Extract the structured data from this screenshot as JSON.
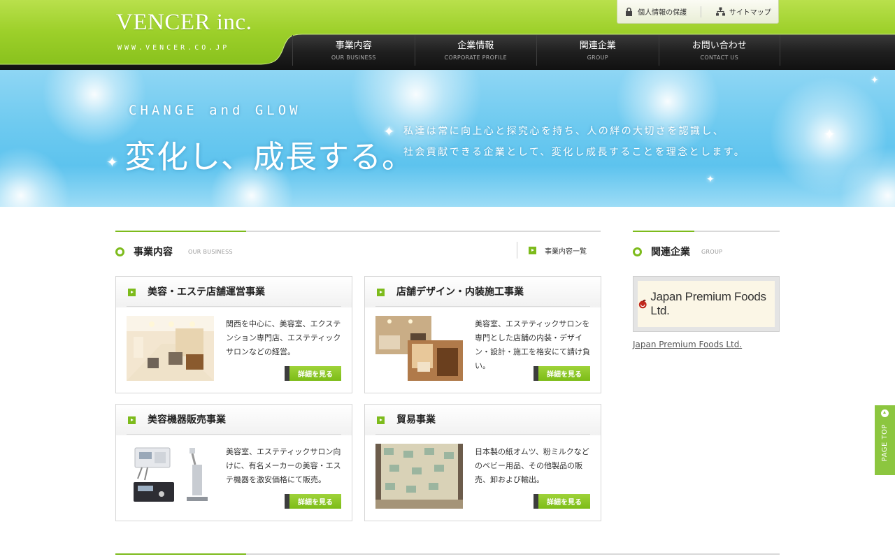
{
  "header": {
    "logo_title": "VENCER inc.",
    "logo_url": "WWW.VENCER.CO.JP",
    "util_links": [
      {
        "label": "個人情報の保護",
        "icon": "lock-icon"
      },
      {
        "label": "サイトマップ",
        "icon": "sitemap-icon"
      }
    ],
    "nav": [
      {
        "jp": "事業内容",
        "en": "OUR BUSINESS"
      },
      {
        "jp": "企業情報",
        "en": "CORPORATE PROFILE"
      },
      {
        "jp": "関連企業",
        "en": "GROUP"
      },
      {
        "jp": "お問い合わせ",
        "en": "CONTACT US"
      }
    ]
  },
  "hero": {
    "sub": "CHANGE and GLOW",
    "main": "変化し、成長する。",
    "text1": "私達は常に向上心と探究心を持ち、人の絆の大切さを認識し、",
    "text2": "社会貢献できる企業として、変化し成長することを理念とします。"
  },
  "business": {
    "title": "事業内容",
    "en": "OUR BUSINESS",
    "more_label": "事業内容一覧",
    "detail_label": "詳細を見る",
    "cards": [
      {
        "title": "美容・エステ店舗運営事業",
        "desc": "関西を中心に、美容室、エクステンション専門店、エステティックサロンなどの経営。"
      },
      {
        "title": "店舗デザイン・内装施工事業",
        "desc": "美容室、エステティックサロンを専門とした店舗の内装・デザイン・設計・施工を格安にて請け負い。"
      },
      {
        "title": "美容機器販売事業",
        "desc": "美容室、エステティックサロン向けに、有名メーカーの美容・エステ機器を激安価格にて販売。"
      },
      {
        "title": "貿易事業",
        "desc": "日本製の紙オムツ、粉ミルクなどのベビー用品、その他製品の販売、卸および輸出。"
      }
    ]
  },
  "group": {
    "title": "関連企業",
    "en": "GROUP",
    "logo_text": "Japan Premium Foods Ltd.",
    "link_text": "Japan Premium Foods Ltd."
  },
  "page_top": {
    "label": "PAGE TOP"
  },
  "colors": {
    "accent": "#7dbb1c",
    "header_green": "#9dd02a",
    "nav_black": "#1e1e1e",
    "hero_blue": "#6ecaf0"
  }
}
